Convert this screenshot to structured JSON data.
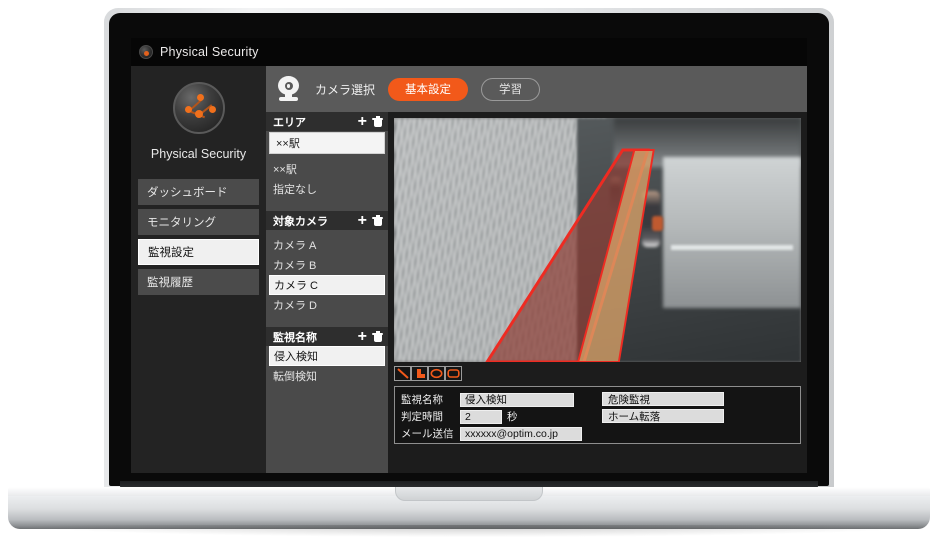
{
  "window": {
    "title": "Physical Security",
    "logo_icon": "network-nodes-logo"
  },
  "sidebar": {
    "brand_name": "Physical Security",
    "brand_logo_icon": "network-nodes-logo",
    "items": [
      {
        "label": "ダッシュボード",
        "active": false
      },
      {
        "label": "モニタリング",
        "active": false
      },
      {
        "label": "監視設定",
        "active": true
      },
      {
        "label": "監視履歴",
        "active": false
      }
    ]
  },
  "toolbar": {
    "camera_icon": "webcam-icon",
    "label": "カメラ選択",
    "tabs": [
      {
        "label": "基本設定",
        "active": true
      },
      {
        "label": "学習",
        "active": false
      }
    ]
  },
  "panels": {
    "area": {
      "title": "エリア",
      "add_icon": "plus-icon",
      "delete_icon": "trash-icon",
      "selected_value": "××駅",
      "items": [
        "××駅",
        "指定なし"
      ]
    },
    "camera": {
      "title": "対象カメラ",
      "add_icon": "plus-icon",
      "delete_icon": "trash-icon",
      "items": [
        {
          "label": "カメラ A",
          "selected": false
        },
        {
          "label": "カメラ B",
          "selected": false
        },
        {
          "label": "カメラ C",
          "selected": true
        },
        {
          "label": "カメラ D",
          "selected": false
        }
      ]
    },
    "monitor_name": {
      "title": "監視名称",
      "add_icon": "plus-icon",
      "delete_icon": "trash-icon",
      "items": [
        {
          "label": "侵入検知",
          "selected": true
        },
        {
          "label": "転倒検知",
          "selected": false
        }
      ]
    }
  },
  "video": {
    "zone_color": "#ee2b22",
    "description": "駅ホーム監視映像"
  },
  "tools": [
    {
      "icon": "line-tool-icon"
    },
    {
      "icon": "polygon-tool-icon"
    },
    {
      "icon": "ellipse-tool-icon"
    },
    {
      "icon": "rectangle-tool-icon"
    }
  ],
  "form": {
    "fields": [
      {
        "label": "監視名称",
        "value": "侵入検知",
        "unit": ""
      },
      {
        "label": "判定時間",
        "value": "2",
        "unit": "秒"
      },
      {
        "label": "メール送信",
        "value": "xxxxxx@optim.co.jp",
        "unit": ""
      }
    ],
    "chips": [
      "危険監視",
      "ホーム転落"
    ]
  },
  "colors": {
    "accent_orange": "#f2591a",
    "zone_red": "#ee2b22",
    "panel_gray": "#4a4a4a",
    "sidebar_dark": "#232323"
  }
}
